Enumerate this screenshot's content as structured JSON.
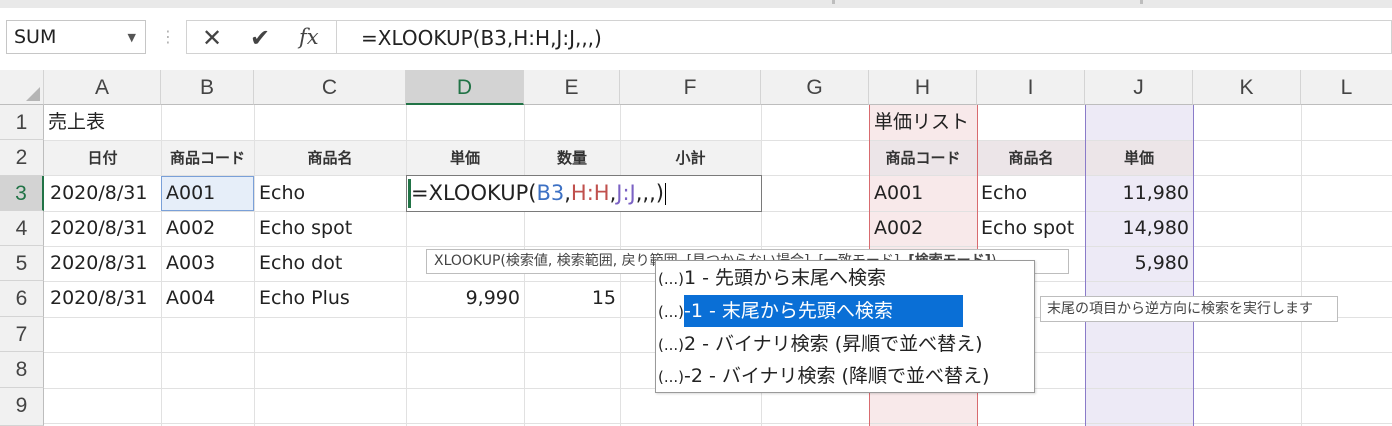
{
  "name_box": {
    "value": "SUM"
  },
  "formula_bar": {
    "cancel_icon": "✕",
    "enter_icon": "✔",
    "fx_label": "fx",
    "formula": "=XLOOKUP(B3,H:H,J:J,,,)"
  },
  "columns": [
    "A",
    "B",
    "C",
    "D",
    "E",
    "F",
    "G",
    "H",
    "I",
    "J",
    "K",
    "L"
  ],
  "rows": [
    "1",
    "2",
    "3",
    "4",
    "5",
    "6",
    "7",
    "8",
    "9"
  ],
  "sheet": {
    "title": "売上表",
    "headers": [
      "日付",
      "商品コード",
      "商品名",
      "単価",
      "数量",
      "小計"
    ],
    "data": [
      [
        "2020/8/31",
        "A001",
        "Echo"
      ],
      [
        "2020/8/31",
        "A002",
        "Echo spot"
      ],
      [
        "2020/8/31",
        "A003",
        "Echo dot"
      ],
      [
        "2020/8/31",
        "A004",
        "Echo Plus",
        "9,990",
        "15"
      ]
    ]
  },
  "edit_cell": {
    "prefix": "=XLOOKUP(",
    "arg1": "B3",
    "sep1": ",",
    "arg2": "H:H",
    "sep2": ",",
    "arg3": "J:J",
    "tail": ",,,)"
  },
  "price_list": {
    "title": "単価リスト",
    "headers": [
      "商品コード",
      "商品名",
      "単価"
    ],
    "rows": [
      [
        "A001",
        "Echo",
        "11,980"
      ],
      [
        "A002",
        "Echo spot",
        "14,980"
      ],
      [
        "",
        "",
        "5,980"
      ]
    ]
  },
  "function_tooltip": {
    "text": "XLOOKUP(検索値, 検索範囲, 戻り範囲, [見つからない場合], [一致モード], ",
    "bold": "[検索モード]",
    "end": ")"
  },
  "autocomplete": {
    "items": [
      {
        "prefix": "(...)",
        "label": "1 - 先頭から末尾へ検索"
      },
      {
        "prefix": "(...)",
        "label": "-1 - 末尾から先頭へ検索"
      },
      {
        "prefix": "(...)",
        "label": "2 - バイナリ検索 (昇順で並べ替え)"
      },
      {
        "prefix": "(...)",
        "label": "-2 - バイナリ検索 (降順で並べ替え)"
      }
    ],
    "selected_index": 1
  },
  "side_tooltip": {
    "text": "末尾の項目から逆方向に検索を実行します"
  },
  "colors": {
    "accent_green": "#217346",
    "selection_blue": "#0a6fd6",
    "h_border": "#d86b6f",
    "j_border": "#8a7bc9"
  }
}
